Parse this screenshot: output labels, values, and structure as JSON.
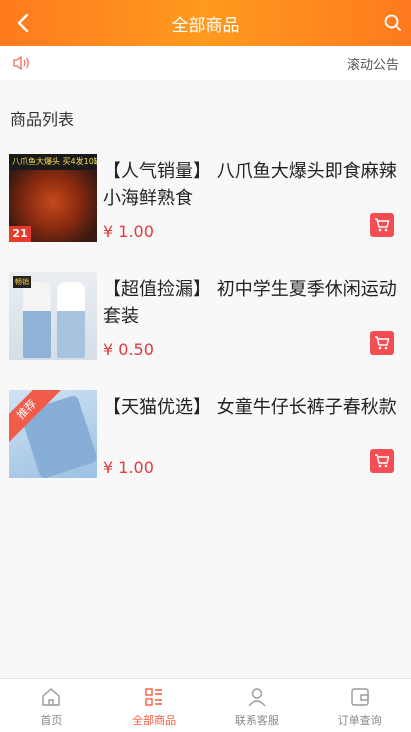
{
  "header": {
    "title": "全部商品",
    "back_icon": "chevron-left-icon",
    "search_icon": "search-icon"
  },
  "notice": {
    "icon": "speaker-icon",
    "text": "滚动公告"
  },
  "section": {
    "title": "商品列表"
  },
  "products": [
    {
      "name": "【人气销量】 八爪鱼大爆头即食麻辣小海鲜熟食",
      "price": "¥ 1.00",
      "thumb_text": "八爪鱼大爆头 买4发10罐",
      "thumb_badge": "21"
    },
    {
      "name": "【超值捡漏】 初中学生夏季休闲运动套装",
      "price": "¥ 0.50",
      "thumb_text": "畅销"
    },
    {
      "name": "【天猫优选】 女童牛仔长裤子春秋款",
      "price": "¥ 1.00",
      "thumb_text": "推荐"
    }
  ],
  "tabbar": [
    {
      "label": "首页",
      "icon": "home-icon",
      "active": false
    },
    {
      "label": "全部商品",
      "icon": "list-icon",
      "active": true
    },
    {
      "label": "联系客服",
      "icon": "user-icon",
      "active": false
    },
    {
      "label": "订单查询",
      "icon": "wallet-icon",
      "active": false
    }
  ],
  "colors": {
    "header": "#ff8a1e",
    "price": "#e23b3b",
    "cart": "#f24e54",
    "active_tab": "#ff5a3a"
  }
}
